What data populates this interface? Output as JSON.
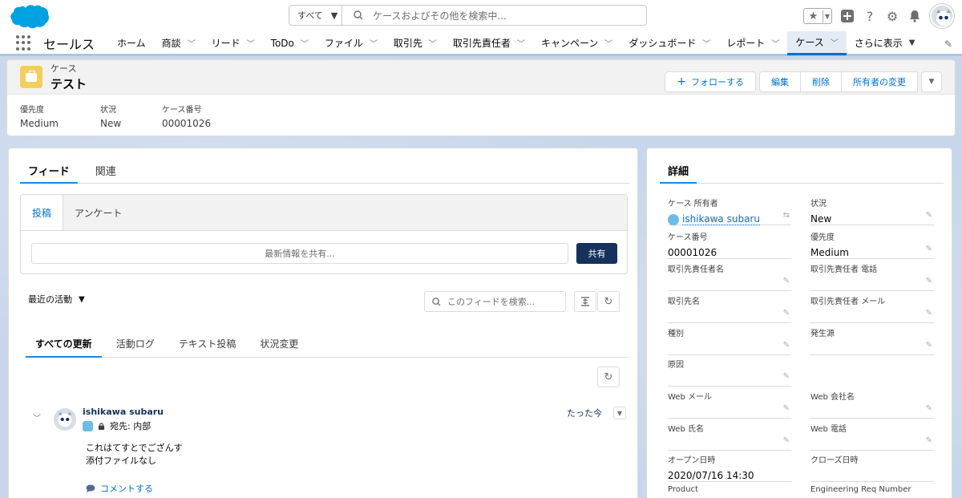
{
  "header": {
    "search_scope": "すべて",
    "search_placeholder": "ケースおよびその他を検索中..."
  },
  "nav": {
    "app_name": "セールス",
    "items": [
      {
        "label": "ホーム",
        "has_menu": false
      },
      {
        "label": "商談",
        "has_menu": true
      },
      {
        "label": "リード",
        "has_menu": true
      },
      {
        "label": "ToDo",
        "has_menu": true
      },
      {
        "label": "ファイル",
        "has_menu": true
      },
      {
        "label": "取引先",
        "has_menu": true
      },
      {
        "label": "取引先責任者",
        "has_menu": true
      },
      {
        "label": "キャンペーン",
        "has_menu": true
      },
      {
        "label": "ダッシュボード",
        "has_menu": true
      },
      {
        "label": "レポート",
        "has_menu": true
      },
      {
        "label": "ケース",
        "has_menu": true,
        "active": true
      }
    ],
    "more_label": "さらに表示"
  },
  "record": {
    "type": "ケース",
    "name": "テスト",
    "follow_label": "フォローする",
    "actions": [
      "編集",
      "削除",
      "所有者の変更"
    ],
    "highlights": [
      {
        "label": "優先度",
        "value": "Medium"
      },
      {
        "label": "状況",
        "value": "New"
      },
      {
        "label": "ケース番号",
        "value": "00001026"
      }
    ]
  },
  "feed": {
    "tabs": [
      "フィード",
      "関連"
    ],
    "publisher_tabs": [
      "投稿",
      "アンケート"
    ],
    "publisher_placeholder": "最新情報を共有...",
    "share_label": "共有",
    "sort_label": "最近の活動",
    "search_placeholder": "このフィードを検索...",
    "filter_tabs": [
      "すべての更新",
      "活動ログ",
      "テキスト投稿",
      "状況変更"
    ],
    "post": {
      "author": "ishikawa subaru",
      "to": "宛先: 内部",
      "time": "たった今",
      "body_lines": [
        "これはてすとでござんす",
        "添付ファイルなし"
      ],
      "comment_label": "コメントする"
    }
  },
  "details": {
    "tab": "詳細",
    "fields": [
      {
        "label": "ケース 所有者",
        "value": "ishikawa subaru",
        "link": true
      },
      {
        "label": "状況",
        "value": "New"
      },
      {
        "label": "ケース番号",
        "value": "00001026"
      },
      {
        "label": "優先度",
        "value": "Medium"
      },
      {
        "label": "取引先責任者名",
        "value": ""
      },
      {
        "label": "取引先責任者 電話",
        "value": ""
      },
      {
        "label": "取引先名",
        "value": ""
      },
      {
        "label": "取引先責任者 メール",
        "value": ""
      },
      {
        "label": "種別",
        "value": ""
      },
      {
        "label": "発生源",
        "value": ""
      },
      {
        "label": "原因",
        "value": ""
      },
      {
        "label": "",
        "value": ""
      },
      {
        "label": "Web メール",
        "value": ""
      },
      {
        "label": "Web 会社名",
        "value": ""
      },
      {
        "label": "Web 氏名",
        "value": ""
      },
      {
        "label": "Web 電話",
        "value": ""
      },
      {
        "label": "オープン日時",
        "value": "2020/07/16 14:30"
      },
      {
        "label": "クローズ日時",
        "value": ""
      },
      {
        "label": "Product",
        "value": ""
      },
      {
        "label": "Engineering Req Number",
        "value": ""
      }
    ]
  },
  "colors": {
    "brand": "#00a1e0",
    "link": "#0070d2",
    "primary_button": "#16325c",
    "case_icon": "#f2cf5b"
  }
}
